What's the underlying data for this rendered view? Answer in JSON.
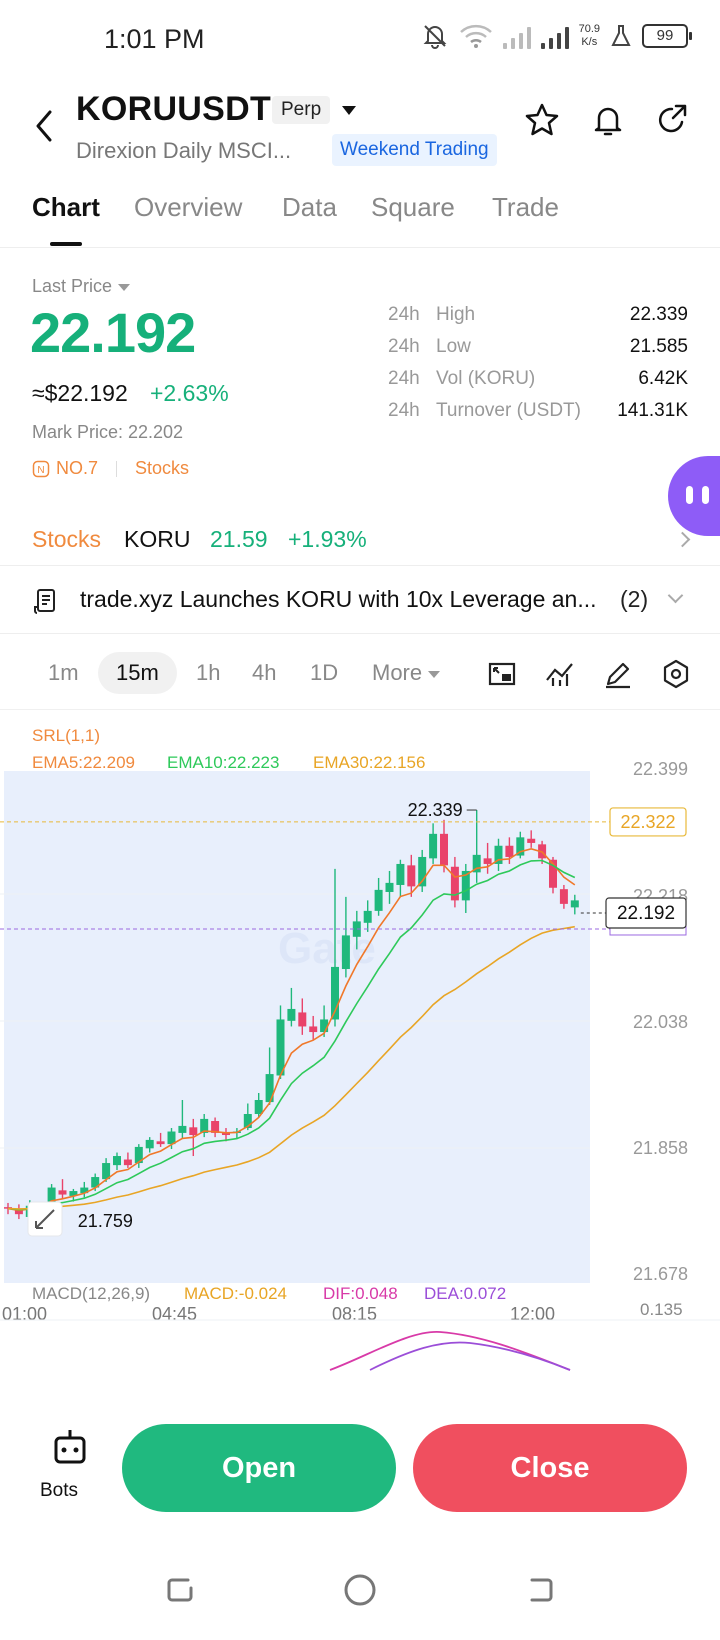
{
  "status": {
    "time": "1:01 PM",
    "speed_top": "70.9",
    "speed_bottom": "K/s",
    "battery": "99"
  },
  "header": {
    "symbol": "KORUUSDT",
    "badge": "Perp",
    "subtitle": "Direxion Daily MSCI...",
    "weekend": "Weekend Trading"
  },
  "tabs": [
    "Chart",
    "Overview",
    "Data",
    "Square",
    "Trade"
  ],
  "price": {
    "label": "Last Price",
    "last": "22.192",
    "usd": "≈$22.192",
    "change_pct": "+2.63%",
    "mark": "Mark Price: 22.202",
    "rank": "NO.7",
    "category": "Stocks"
  },
  "stats": [
    {
      "period": "24h",
      "label": "High",
      "value": "22.339"
    },
    {
      "period": "24h",
      "label": "Low",
      "value": "21.585"
    },
    {
      "period": "24h",
      "label": "Vol (KORU)",
      "value": "6.42K"
    },
    {
      "period": "24h",
      "label": "Turnover (USDT)",
      "value": "141.31K"
    }
  ],
  "stocks": {
    "label": "Stocks",
    "ticker": "KORU",
    "price": "21.59",
    "change": "+1.93%"
  },
  "news": {
    "text": "trade.xyz Launches KORU with 10x Leverage an...",
    "count": "(2)"
  },
  "intervals": {
    "items": [
      "1m",
      "15m",
      "1h",
      "4h",
      "1D"
    ],
    "more": "More",
    "active": "15m"
  },
  "indicators": {
    "srl": "SRL(1,1)",
    "ema5": "EMA5:22.209",
    "ema10": "EMA10:22.223",
    "ema30": "EMA30:22.156",
    "macd_title": "MACD(12,26,9)",
    "macd": "MACD:-0.024",
    "dif": "DIF:0.048",
    "dea": "DEA:0.072",
    "macd_axis": "0.135"
  },
  "chart_data": {
    "type": "candlestick",
    "interval": "15m",
    "y_ticks": [
      "22.399",
      "22.218",
      "22.038",
      "21.858",
      "21.678"
    ],
    "x_ticks": [
      "01:00",
      "04:45",
      "08:15",
      "12:00"
    ],
    "ylim": [
      21.678,
      22.399
    ],
    "high_label": "22.339",
    "low_label": "21.759",
    "dashed_price": "22.322",
    "current_price": "22.192",
    "colors": {
      "up": "#1fb87c",
      "down": "#e9436a",
      "ema5": "#f0782a",
      "ema10": "#2ec95a",
      "ema30": "#e8a525"
    },
    "candles": [
      {
        "o": 21.772,
        "h": 21.778,
        "l": 21.762,
        "c": 21.77
      },
      {
        "o": 21.768,
        "h": 21.776,
        "l": 21.755,
        "c": 21.762
      },
      {
        "o": 21.758,
        "h": 21.782,
        "l": 21.752,
        "c": 21.774
      },
      {
        "o": 21.77,
        "h": 21.778,
        "l": 21.762,
        "c": 21.775
      },
      {
        "o": 21.774,
        "h": 21.805,
        "l": 21.77,
        "c": 21.8
      },
      {
        "o": 21.796,
        "h": 21.812,
        "l": 21.784,
        "c": 21.79
      },
      {
        "o": 21.788,
        "h": 21.798,
        "l": 21.78,
        "c": 21.795
      },
      {
        "o": 21.792,
        "h": 21.808,
        "l": 21.786,
        "c": 21.8
      },
      {
        "o": 21.8,
        "h": 21.82,
        "l": 21.795,
        "c": 21.815
      },
      {
        "o": 21.812,
        "h": 21.842,
        "l": 21.808,
        "c": 21.835
      },
      {
        "o": 21.832,
        "h": 21.85,
        "l": 21.825,
        "c": 21.845
      },
      {
        "o": 21.84,
        "h": 21.85,
        "l": 21.828,
        "c": 21.832
      },
      {
        "o": 21.835,
        "h": 21.862,
        "l": 21.828,
        "c": 21.858
      },
      {
        "o": 21.856,
        "h": 21.872,
        "l": 21.85,
        "c": 21.868
      },
      {
        "o": 21.866,
        "h": 21.878,
        "l": 21.858,
        "c": 21.862
      },
      {
        "o": 21.862,
        "h": 21.885,
        "l": 21.855,
        "c": 21.88
      },
      {
        "o": 21.878,
        "h": 21.925,
        "l": 21.87,
        "c": 21.888
      },
      {
        "o": 21.886,
        "h": 21.898,
        "l": 21.845,
        "c": 21.875
      },
      {
        "o": 21.878,
        "h": 21.905,
        "l": 21.872,
        "c": 21.898
      },
      {
        "o": 21.895,
        "h": 21.9,
        "l": 21.872,
        "c": 21.878
      },
      {
        "o": 21.878,
        "h": 21.885,
        "l": 21.866,
        "c": 21.875
      },
      {
        "o": 21.878,
        "h": 21.885,
        "l": 21.87,
        "c": 21.88
      },
      {
        "o": 21.885,
        "h": 21.92,
        "l": 21.882,
        "c": 21.905
      },
      {
        "o": 21.905,
        "h": 21.935,
        "l": 21.9,
        "c": 21.925
      },
      {
        "o": 21.922,
        "h": 22.0,
        "l": 21.918,
        "c": 21.962
      },
      {
        "o": 21.96,
        "h": 22.06,
        "l": 21.955,
        "c": 22.04
      },
      {
        "o": 22.038,
        "h": 22.085,
        "l": 22.03,
        "c": 22.055
      },
      {
        "o": 22.05,
        "h": 22.07,
        "l": 22.018,
        "c": 22.03
      },
      {
        "o": 22.03,
        "h": 22.045,
        "l": 22.01,
        "c": 22.022
      },
      {
        "o": 22.022,
        "h": 22.06,
        "l": 22.015,
        "c": 22.04
      },
      {
        "o": 22.04,
        "h": 22.255,
        "l": 22.03,
        "c": 22.115
      },
      {
        "o": 22.112,
        "h": 22.215,
        "l": 22.1,
        "c": 22.16
      },
      {
        "o": 22.158,
        "h": 22.195,
        "l": 22.14,
        "c": 22.18
      },
      {
        "o": 22.178,
        "h": 22.21,
        "l": 22.165,
        "c": 22.195
      },
      {
        "o": 22.195,
        "h": 22.242,
        "l": 22.188,
        "c": 22.225
      },
      {
        "o": 22.222,
        "h": 22.252,
        "l": 22.205,
        "c": 22.235
      },
      {
        "o": 22.232,
        "h": 22.268,
        "l": 22.215,
        "c": 22.262
      },
      {
        "o": 22.26,
        "h": 22.275,
        "l": 22.215,
        "c": 22.23
      },
      {
        "o": 22.23,
        "h": 22.282,
        "l": 22.222,
        "c": 22.272
      },
      {
        "o": 22.27,
        "h": 22.32,
        "l": 22.262,
        "c": 22.305
      },
      {
        "o": 22.305,
        "h": 22.325,
        "l": 22.25,
        "c": 22.26
      },
      {
        "o": 22.258,
        "h": 22.272,
        "l": 22.2,
        "c": 22.21
      },
      {
        "o": 22.21,
        "h": 22.262,
        "l": 22.192,
        "c": 22.252
      },
      {
        "o": 22.25,
        "h": 22.339,
        "l": 22.235,
        "c": 22.275
      },
      {
        "o": 22.27,
        "h": 22.292,
        "l": 22.248,
        "c": 22.262
      },
      {
        "o": 22.262,
        "h": 22.298,
        "l": 22.252,
        "c": 22.288
      },
      {
        "o": 22.288,
        "h": 22.3,
        "l": 22.262,
        "c": 22.272
      },
      {
        "o": 22.274,
        "h": 22.308,
        "l": 22.27,
        "c": 22.3
      },
      {
        "o": 22.298,
        "h": 22.31,
        "l": 22.285,
        "c": 22.292
      },
      {
        "o": 22.29,
        "h": 22.295,
        "l": 22.262,
        "c": 22.27
      },
      {
        "o": 22.268,
        "h": 22.272,
        "l": 22.22,
        "c": 22.228
      },
      {
        "o": 22.226,
        "h": 22.232,
        "l": 22.198,
        "c": 22.205
      },
      {
        "o": 22.2,
        "h": 22.218,
        "l": 22.19,
        "c": 22.21
      }
    ]
  },
  "bottom": {
    "bots": "Bots",
    "open": "Open",
    "close": "Close"
  }
}
